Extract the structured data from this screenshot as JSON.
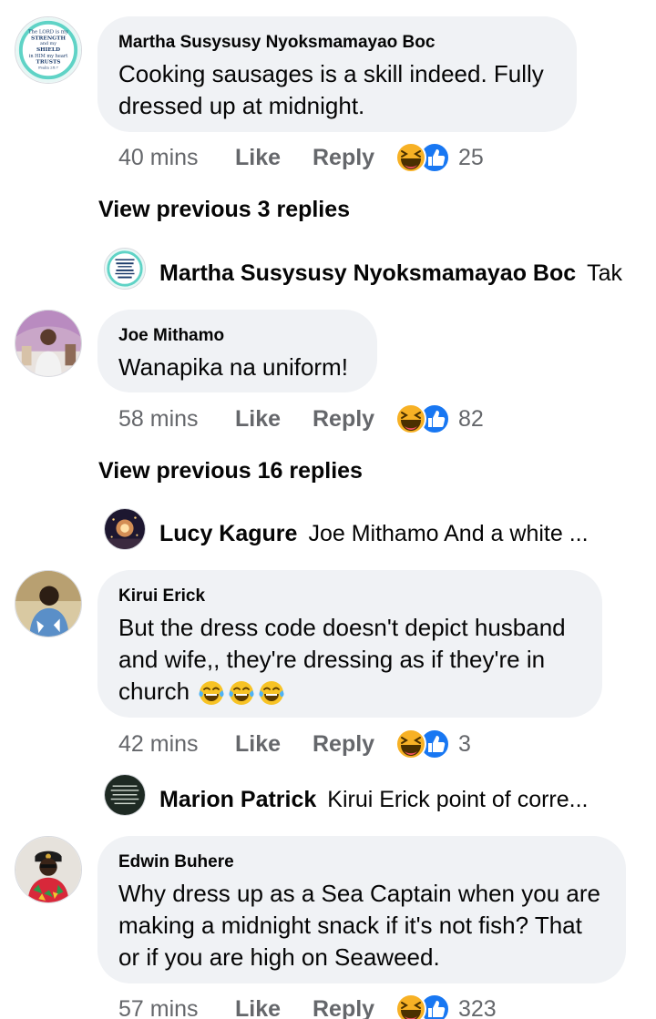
{
  "comments": [
    {
      "author": "Martha Susysusy Nyoksmamayao Boc",
      "text": "Cooking sausages is a skill indeed. Fully dressed up at midnight.",
      "avatar_text": [
        "The LORD is my",
        "STRENGTH",
        "and my",
        "SHIELD",
        "in HIM my heart",
        "TRUSTS",
        "Psalm 28:7"
      ],
      "time": "40 mins",
      "like_label": "Like",
      "reply_label": "Reply",
      "reaction_icons": [
        "haha-icon",
        "like-icon"
      ],
      "reaction_count": "25",
      "view_previous": "View previous 3 replies",
      "reply": {
        "author": "Martha Susysusy Nyoksmamayao Boc",
        "text": "Tak"
      }
    },
    {
      "author": "Joe Mithamo",
      "text": "Wanapika na uniform!",
      "time": "58 mins",
      "like_label": "Like",
      "reply_label": "Reply",
      "reaction_icons": [
        "haha-icon",
        "like-icon"
      ],
      "reaction_count": "82",
      "view_previous": "View previous 16 replies",
      "reply": {
        "author": "Lucy Kagure",
        "text": "Joe Mithamo And a white ..."
      }
    },
    {
      "author": "Kirui Erick",
      "text": "But the dress code doesn't depict husband and wife,, they're dressing as if they're in church",
      "emoji_icons": [
        "tears-of-joy-icon",
        "tears-of-joy-icon",
        "tears-of-joy-icon"
      ],
      "time": "42 mins",
      "like_label": "Like",
      "reply_label": "Reply",
      "reaction_icons": [
        "haha-icon",
        "like-icon"
      ],
      "reaction_count": "3",
      "reply": {
        "author": "Marion Patrick",
        "text": "Kirui Erick point of corre..."
      }
    },
    {
      "author": "Edwin Buhere",
      "text": "Why dress up as a Sea Captain when you are making a midnight snack if it's not fish? That or if you are high on Seaweed.",
      "time": "57 mins",
      "like_label": "Like",
      "reply_label": "Reply",
      "reaction_icons": [
        "haha-icon",
        "like-icon"
      ],
      "reaction_count": "323"
    }
  ],
  "colors": {
    "bubble": "#f0f2f5",
    "meta_text": "#65676b",
    "primary_text": "#050505",
    "like_blue": "#1877f2",
    "haha_yellow": "#f7b125"
  }
}
